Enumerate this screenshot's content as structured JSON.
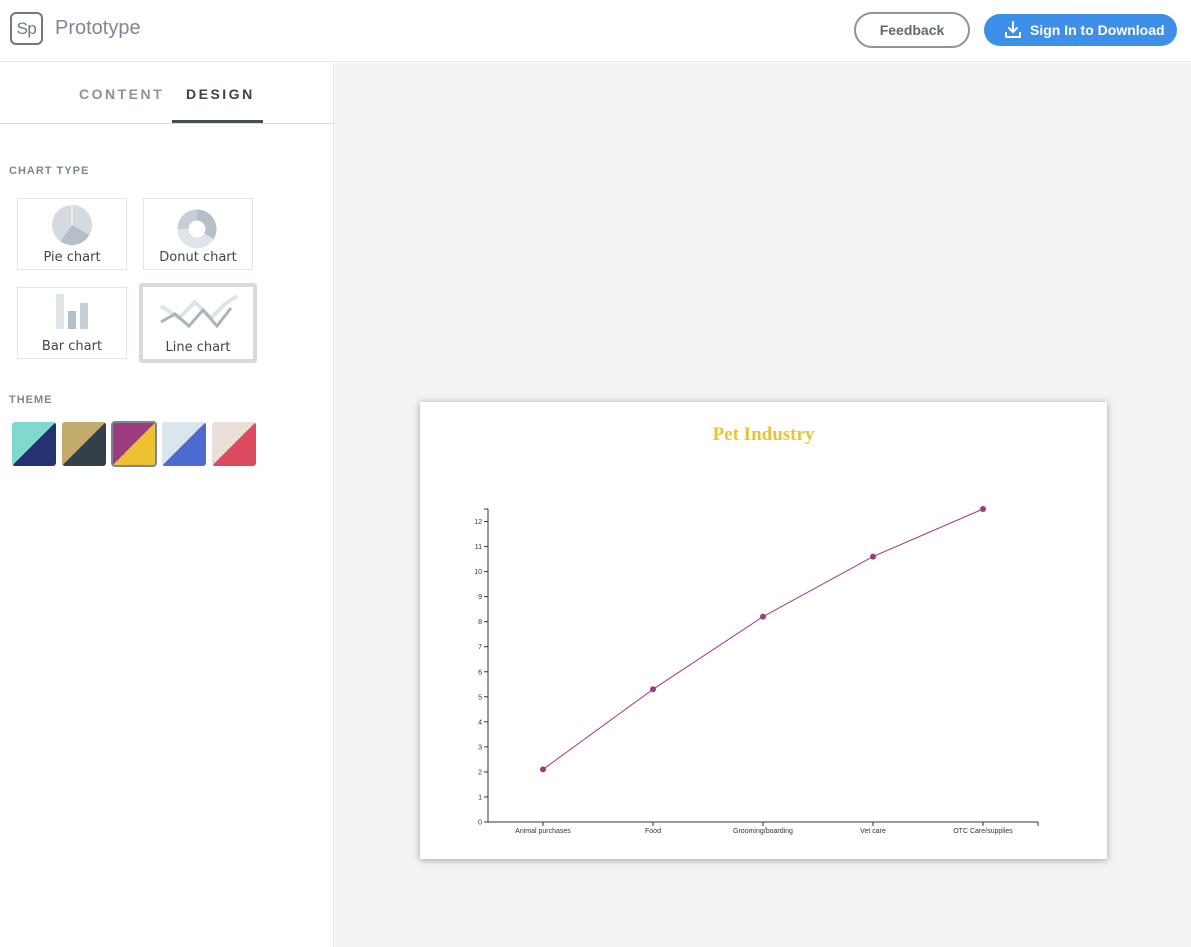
{
  "app": {
    "logo_text": "Sp",
    "title": "Prototype",
    "feedback_label": "Feedback",
    "signin_label": "Sign In to Download",
    "accent_color": "#3d8fe8"
  },
  "sidebar": {
    "tabs": [
      {
        "label": "CONTENT",
        "active": false
      },
      {
        "label": "DESIGN",
        "active": true
      }
    ],
    "chart_type_label": "CHART TYPE",
    "chart_types": [
      {
        "label": "Pie chart",
        "icon": "pie-chart-icon",
        "selected": false
      },
      {
        "label": "Donut chart",
        "icon": "donut-chart-icon",
        "selected": false
      },
      {
        "label": "Bar chart",
        "icon": "bar-chart-icon",
        "selected": false
      },
      {
        "label": "Line chart",
        "icon": "line-chart-icon",
        "selected": true
      }
    ],
    "theme_label": "THEME",
    "themes": [
      {
        "colors": [
          "#7fd9cf",
          "#24326f"
        ],
        "selected": false
      },
      {
        "colors": [
          "#c2aa6b",
          "#343f4a"
        ],
        "selected": false
      },
      {
        "colors": [
          "#9c3c7f",
          "#ecc233"
        ],
        "selected": true
      },
      {
        "colors": [
          "#dbe5ef",
          "#4d6ad1"
        ],
        "selected": false
      },
      {
        "colors": [
          "#e9e1d9",
          "#dc4a5f"
        ],
        "selected": false
      }
    ]
  },
  "chart_data": {
    "type": "line",
    "title": "Pet Industry",
    "title_color": "#ecc233",
    "line_color": "#9c3c7f",
    "categories": [
      "Animal purchases",
      "Food",
      "Grooming/boarding",
      "Vet care",
      "OTC Care/supplies"
    ],
    "values": [
      2.1,
      5.3,
      8.2,
      10.6,
      12.5
    ],
    "ylim": [
      0,
      12.5
    ],
    "yticks": [
      0,
      1,
      2,
      3,
      4,
      5,
      6,
      7,
      8,
      9,
      10,
      11,
      12
    ],
    "grid": false,
    "legend": "none",
    "xlabel": "",
    "ylabel": ""
  }
}
